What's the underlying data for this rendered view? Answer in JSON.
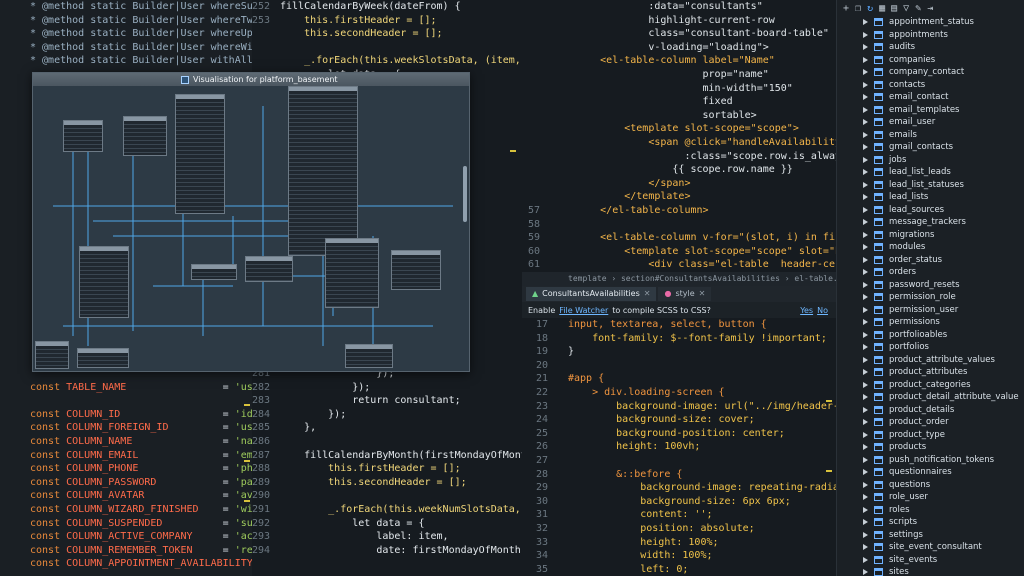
{
  "left_code": [
    {
      "t": "* @method static Builder|User whereSuspended($valu",
      "c": "doc"
    },
    {
      "t": "* @method static Builder|User whereTwoFactorAuth($",
      "c": "doc"
    },
    {
      "t": "* @method static Builder|User whereUpdatedAt($valu",
      "c": "doc"
    },
    {
      "t": "* @method static Builder|User whereWizardFinished(",
      "c": "doc"
    },
    {
      "t": "* @method static Builder|User withAllTags($tags, $",
      "c": "doc"
    },
    {
      "t": "",
      "c": "doc"
    },
    {
      "t": "",
      "c": "doc"
    },
    {
      "t": "",
      "c": "doc"
    },
    {
      "t": "",
      "c": "doc"
    },
    {
      "t": "",
      "c": "doc"
    },
    {
      "t": "",
      "c": "doc"
    },
    {
      "t": "",
      "c": "doc"
    },
    {
      "t": "",
      "c": "doc"
    },
    {
      "t": "",
      "c": "doc"
    },
    {
      "t": "",
      "c": "doc"
    },
    {
      "t": "",
      "c": "doc"
    },
    {
      "t": "",
      "c": "doc"
    },
    {
      "t": "",
      "c": "doc"
    },
    {
      "t": "",
      "c": "doc"
    },
    {
      "t": "",
      "c": "doc"
    },
    {
      "t": "",
      "c": "doc"
    },
    {
      "t": "",
      "c": "doc"
    },
    {
      "t": "",
      "c": "doc"
    },
    {
      "t": "",
      "c": "doc"
    },
    {
      "t": "",
      "c": "doc"
    },
    {
      "t": "",
      "c": "doc"
    },
    {
      "t": "",
      "c": "doc"
    },
    {
      "t": "",
      "c": "doc"
    },
    {
      "t": "const TABLE_NAME = 'users';",
      "c": "const"
    },
    {
      "t": "",
      "c": "doc"
    },
    {
      "t": "const COLUMN_ID = 'id';",
      "c": "const"
    },
    {
      "t": "const COLUMN_FOREIGN_ID = 'user_id';",
      "c": "const"
    },
    {
      "t": "const COLUMN_NAME = 'name';",
      "c": "const"
    },
    {
      "t": "const COLUMN_EMAIL = 'email';",
      "c": "const"
    },
    {
      "t": "const COLUMN_PHONE = 'phone';",
      "c": "const"
    },
    {
      "t": "const COLUMN_PASSWORD = 'password';",
      "c": "const"
    },
    {
      "t": "const COLUMN_AVATAR = 'avatar';",
      "c": "const"
    },
    {
      "t": "const COLUMN_WIZARD_FINISHED = 'wizard_finis",
      "c": "const"
    },
    {
      "t": "const COLUMN_SUSPENDED = 'suspended';",
      "c": "const"
    },
    {
      "t": "const COLUMN_ACTIVE_COMPANY = 'active_compan",
      "c": "const"
    },
    {
      "t": "const COLUMN_REMEMBER_TOKEN = 'remember_tok",
      "c": "const"
    },
    {
      "t": "const COLUMN_APPOINTMENT_AVAILABILITY = 'appoi",
      "c": "const"
    }
  ],
  "mid_gutter": [
    "252",
    "253",
    "",
    "",
    "",
    "",
    "",
    "",
    "",
    "",
    "",
    "",
    "",
    "",
    "",
    "",
    "",
    "",
    "",
    "",
    "",
    "",
    "",
    "",
    "",
    "",
    "",
    "281",
    "282",
    "283",
    "284",
    "285",
    "286",
    "287",
    "288",
    "289",
    "290",
    "291",
    "292",
    "293",
    "294"
  ],
  "mid_code": [
    "fillCalendarByWeek(dateFrom) {",
    "    this.firstHeader = [];",
    "    this.secondHeader = [];",
    "",
    "    _.forEach(this.weekSlotsData, (item, j) =>",
    "        let data = {",
    "",
    "",
    "",
    "",
    "",
    "",
    "",
    "",
    "",
    "",
    "",
    "",
    "",
    "",
    "",
    "",
    "",
    "",
    "",
    "",
    "",
    "                });",
    "            });",
    "            return consultant;",
    "        });",
    "    },",
    "",
    "    fillCalendarByMonth(firstMondayOfMonth) {",
    "        this.firstHeader = [];",
    "        this.secondHeader = [];",
    "",
    "        _.forEach(this.weekNumSlotsData, (item, j) =>",
    "            let data = {",
    "                label: item,",
    "                date: firstMondayOfMonth.clone().add",
    ""
  ],
  "vue_gutter": [
    "",
    "",
    "",
    "",
    "",
    "",
    "",
    "",
    "",
    "",
    "",
    "",
    "",
    "",
    "",
    "57",
    "58",
    "59",
    "60",
    "61"
  ],
  "vue_code": [
    "                :data=\"consultants\"",
    "                highlight-current-row",
    "                class=\"consultant-board-table\"",
    "                v-loading=\"loading\">",
    "        <el-table-column label=\"Name\"",
    "                         prop=\"name\"",
    "                         min-width=\"150\"",
    "                         fixed",
    "                         sortable>",
    "            <template slot-scope=\"scope\">",
    "                <span @click=\"handleAvailability(scope",
    "                      :class=\"scope.row.is_always_availa",
    "                    {{ scope.row.name }}",
    "                </span>",
    "            </template>",
    "        </el-table-column>",
    "",
    "        <el-table-column v-for=\"(slot, i) in firstHeader",
    "            <template slot-scope=\"scope\" slot=\"header\">",
    "                <div class=\"el-table  header-ce"
  ],
  "breadcrumb": "template  ›  section#ConsultantsAvailabilities  ›  el-table.consultant-board",
  "tabs": [
    {
      "label": "ConsultantsAvailabilities",
      "active": true
    },
    {
      "label": "style",
      "active": false
    }
  ],
  "watcher_notice": {
    "prefix": "Enable",
    "link": "File Watcher",
    "suffix": "to compile SCSS to CSS?",
    "yes": "Yes",
    "no": "No"
  },
  "scss_gutter": [
    "17",
    "18",
    "19",
    "20",
    "21",
    "22",
    "23",
    "24",
    "25",
    "26",
    "27",
    "28",
    "29",
    "30",
    "31",
    "32",
    "33",
    "34",
    "35"
  ],
  "scss_code": [
    "input, textarea, select, button {",
    "    font-family: $--font-family !important;",
    "}",
    "",
    "#app {",
    "    > div.loading-screen {",
    "        background-image: url(\"../img/header-image.jpg\");",
    "        background-size: cover;",
    "        background-position: center;",
    "        height: 100vh;",
    "",
    "        &::before {",
    "            background-image: repeating-radial-gradient(circle at",
    "            background-size: 6px 6px;",
    "            content: '';",
    "            position: absolute;",
    "            height: 100%;",
    "            width: 100%;",
    "            left: 0;"
  ],
  "diagram_title": "Visualisation for platform_basement",
  "tables": [
    "appointment_status",
    "appointments",
    "audits",
    "companies",
    "company_contact",
    "contacts",
    "email_contact",
    "email_templates",
    "email_user",
    "emails",
    "gmail_contacts",
    "jobs",
    "lead_list_leads",
    "lead_list_statuses",
    "lead_lists",
    "lead_sources",
    "message_trackers",
    "migrations",
    "modules",
    "order_status",
    "orders",
    "password_resets",
    "permission_role",
    "permission_user",
    "permissions",
    "portfolioables",
    "portfolios",
    "product_attribute_values",
    "product_attributes",
    "product_categories",
    "product_detail_attribute_value",
    "product_details",
    "product_order",
    "product_type",
    "products",
    "push_notification_tokens",
    "questionnaires",
    "questions",
    "role_user",
    "roles",
    "scripts",
    "settings",
    "site_event_consultant",
    "site_events",
    "sites"
  ],
  "toolbar_icons": [
    "add-icon",
    "copy-icon",
    "refresh-icon",
    "table-icon",
    "grid-icon",
    "filter-icon",
    "edit-icon",
    "export-icon"
  ]
}
